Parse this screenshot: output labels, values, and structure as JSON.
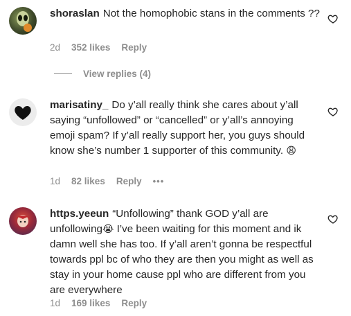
{
  "comments": [
    {
      "username": "shoraslan",
      "text": "Not the homophobic stans in the comments ??",
      "time": "2d",
      "likes": "352 likes",
      "reply": "Reply"
    },
    {
      "username": "marisatiny_",
      "text": "Do y’all really think she cares about y’all saying “unfollowed” or “cancelled” or y’all’s annoying emoji spam? If y’all really support her, you guys should know she’s number 1 supporter of this community.",
      "emoji": "😩",
      "time": "1d",
      "likes": "82 likes",
      "reply": "Reply",
      "more": "•••"
    },
    {
      "username": "https.yeeun",
      "text_before": "“Unfollowing” thank GOD y’all are unfollowing",
      "emoji": "😭",
      "text_after": " I’ve been waiting for this moment and ik damn well she has too. If y’all aren’t gonna be respectful towards ppl bc of who they are then you might as well as stay in your home cause ppl who are different from you are everywhere",
      "time": "1d",
      "likes": "169 likes",
      "reply": "Reply"
    }
  ],
  "view_replies": "View replies (4)",
  "icons": {
    "like": "heart-outline-icon",
    "avatar2_glyph": "black-heart"
  },
  "colors": {
    "text": "#262626",
    "muted": "#8e8e8e"
  }
}
